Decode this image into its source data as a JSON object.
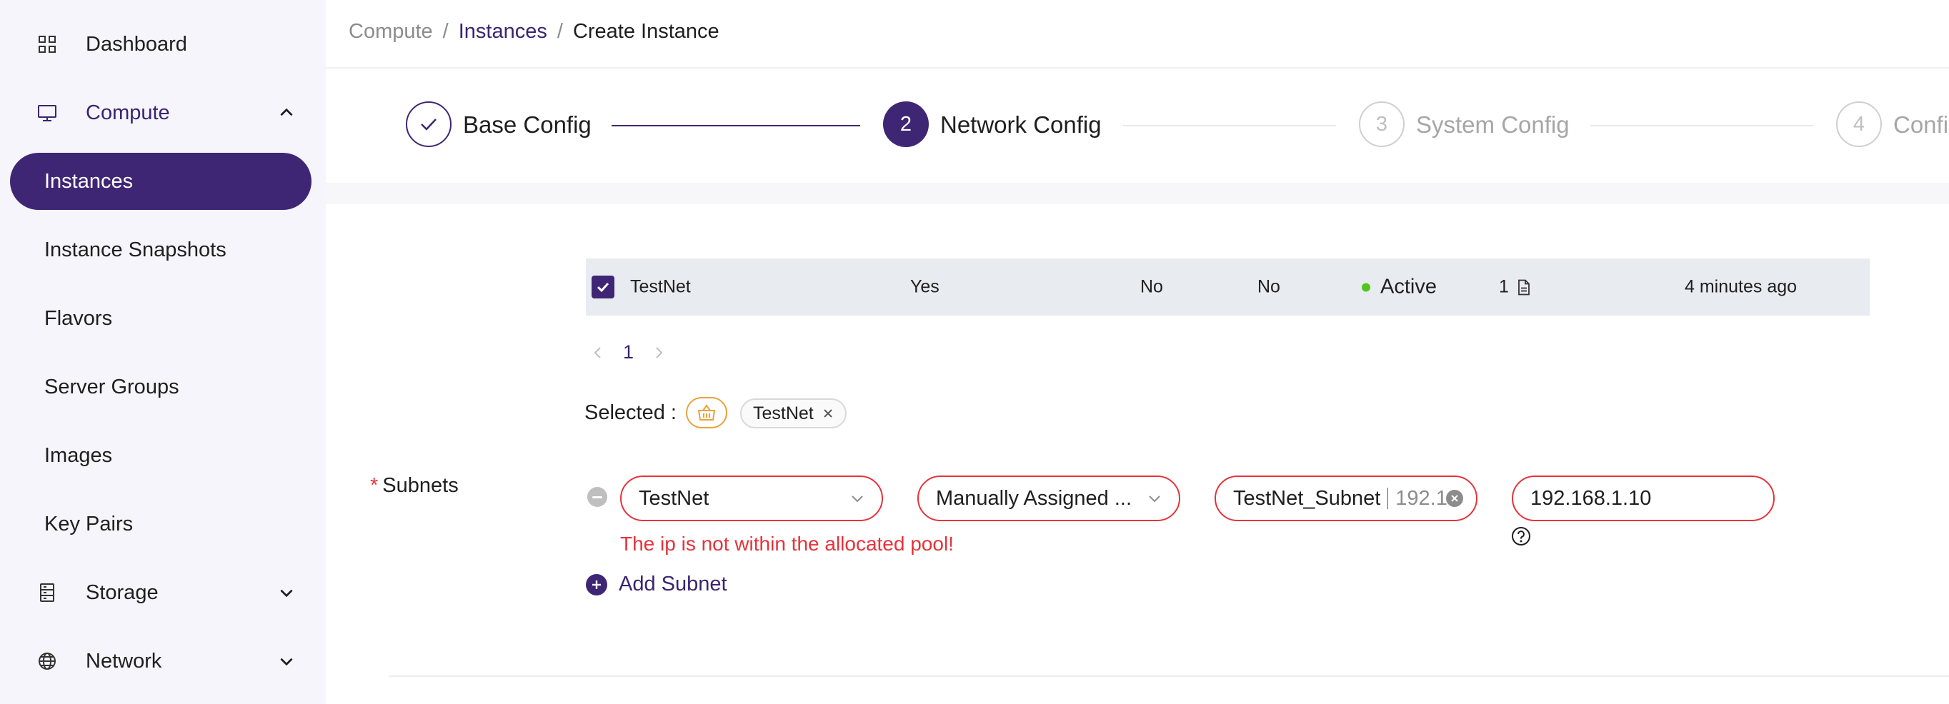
{
  "sidebar": {
    "dashboard": "Dashboard",
    "compute": "Compute",
    "compute_items": [
      "Instances",
      "Instance Snapshots",
      "Flavors",
      "Server Groups",
      "Images",
      "Key Pairs"
    ],
    "storage": "Storage",
    "network": "Network"
  },
  "breadcrumb": {
    "root": "Compute",
    "parent": "Instances",
    "current": "Create Instance",
    "separator": "/"
  },
  "steps": [
    {
      "number": "",
      "title": "Base Config",
      "state": "done"
    },
    {
      "number": "2",
      "title": "Network Config",
      "state": "active"
    },
    {
      "number": "3",
      "title": "System Config",
      "state": "pending"
    },
    {
      "number": "4",
      "title": "Confi",
      "state": "pending"
    }
  ],
  "network_row": {
    "name": "TestNet",
    "shared": "Yes",
    "external": "No",
    "port_security": "No",
    "status": "Active",
    "subnets": "1",
    "created": "4 minutes ago"
  },
  "pagination": {
    "prev": "<",
    "current": "1",
    "next": ">"
  },
  "selected": {
    "label": "Selected :",
    "tag": "TestNet"
  },
  "subnets": {
    "label": "Subnets",
    "required_mark": "*",
    "network_select": "TestNet",
    "assign_select": "Manually Assigned ...",
    "subnet_select": "TestNet_Subnet",
    "subnet_cidr": "192.16",
    "ip_value": "192.168.1.10",
    "error": "The ip is not within the allocated pool!",
    "add_label": "Add Subnet"
  },
  "colors": {
    "primary": "#3f2674",
    "error": "#e5333a",
    "success": "#52c41a",
    "warning": "#e8a33d"
  }
}
